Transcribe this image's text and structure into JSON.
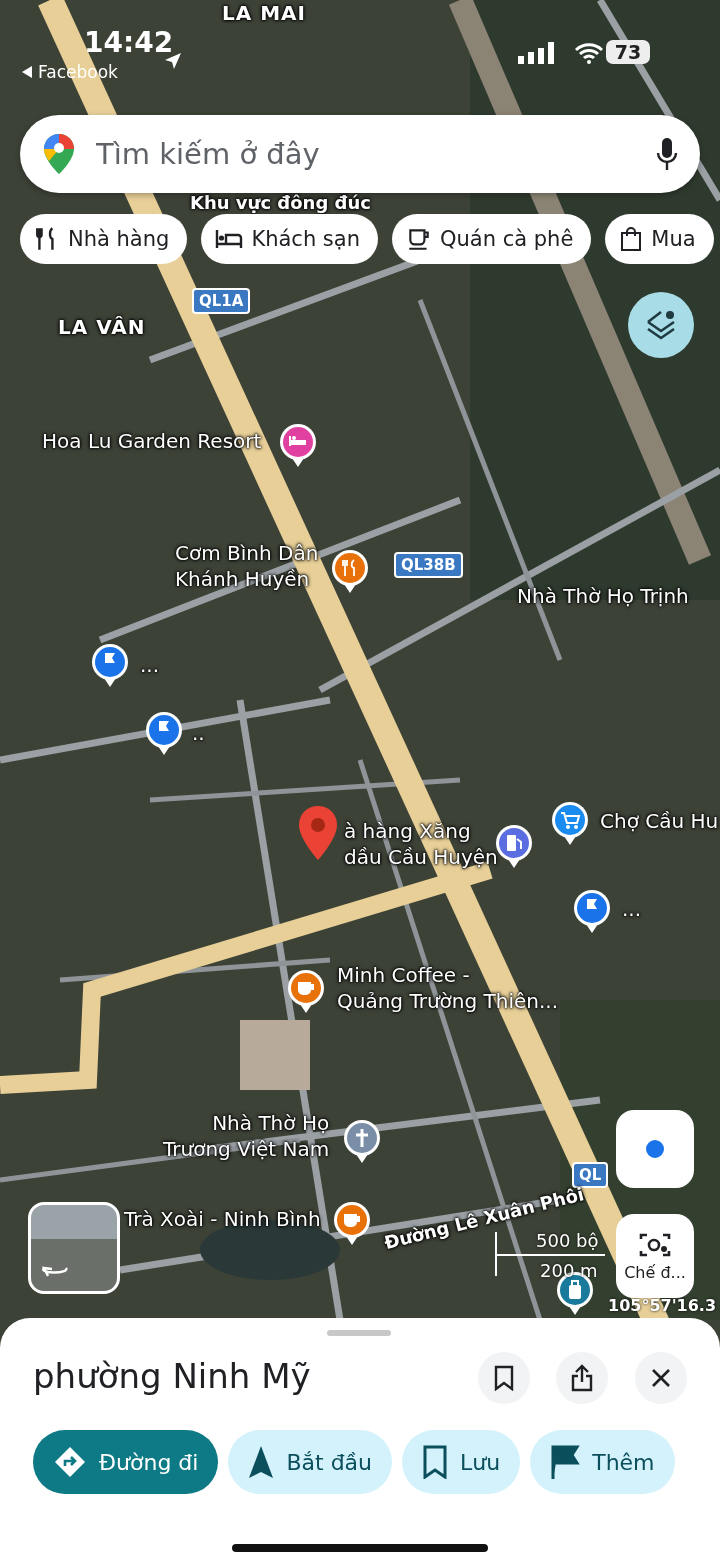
{
  "status_bar": {
    "time": "14:42",
    "back_app": "Facebook",
    "battery": "73"
  },
  "search": {
    "placeholder": "Tìm kiếm ở đây"
  },
  "chips": [
    {
      "label": "Nhà hàng",
      "kind": "restaurant"
    },
    {
      "label": "Khách sạn",
      "kind": "hotel"
    },
    {
      "label": "Quán cà phê",
      "kind": "cafe"
    },
    {
      "label": "Mua",
      "kind": "shopping"
    }
  ],
  "map": {
    "places": [
      {
        "name": "LA MAI",
        "kind": "area"
      },
      {
        "name": "LA VÂN",
        "kind": "area"
      },
      {
        "name": "Khu vực đông đúc",
        "kind": "busy"
      },
      {
        "name": "QL1A",
        "kind": "shield"
      },
      {
        "name": "QL38B",
        "kind": "shield"
      },
      {
        "name": "QL",
        "kind": "shield"
      },
      {
        "name": "Hoa Lu Garden Resort",
        "kind": "hotel",
        "color": "#e040a0"
      },
      {
        "name": "Cơm Bình Dân\nKhánh Huyền",
        "kind": "restaurant",
        "color": "#e8710a"
      },
      {
        "name": "Nhà Thờ Họ Trịnh",
        "kind": "label"
      },
      {
        "name": "...",
        "kind": "flag",
        "color": "#1a73e8"
      },
      {
        "name": "..",
        "kind": "flag",
        "color": "#1a73e8"
      },
      {
        "name": "à hàng Xăng\ndầu Cầu Huyện",
        "kind": "selected",
        "color": "#ea4335"
      },
      {
        "kind": "fuel",
        "color": "#5b6ee1"
      },
      {
        "name": "Chợ Cầu Hu",
        "kind": "shop",
        "color": "#1a8cf0"
      },
      {
        "name": "...",
        "kind": "flag",
        "color": "#1a73e8"
      },
      {
        "name": "Minh Coffee -\nQuảng Trường Thiên...",
        "kind": "cafe",
        "color": "#e8710a"
      },
      {
        "name": "Nhà Thờ Họ\nTrương Việt Nam",
        "kind": "church",
        "color": "#7a8ea8"
      },
      {
        "name": "Trà Xoài - Ninh Bình",
        "kind": "cafe",
        "color": "#e8710a"
      },
      {
        "kind": "luggage",
        "color": "#1a7a9c"
      },
      {
        "name": "Đường Lê Xuân Phôi",
        "kind": "street"
      }
    ],
    "scale": {
      "imperial": "500 bộ",
      "metric": "200 m"
    },
    "coordinates": "105°57'16.3",
    "camera_button": "Chế đ..."
  },
  "sheet": {
    "title": "phường Ninh Mỹ",
    "actions": [
      {
        "label": "Đường đi",
        "kind": "directions",
        "primary": true
      },
      {
        "label": "Bắt đầu",
        "kind": "start",
        "primary": false
      },
      {
        "label": "Lưu",
        "kind": "save",
        "primary": false
      },
      {
        "label": "Thêm",
        "kind": "add",
        "primary": false
      }
    ]
  }
}
